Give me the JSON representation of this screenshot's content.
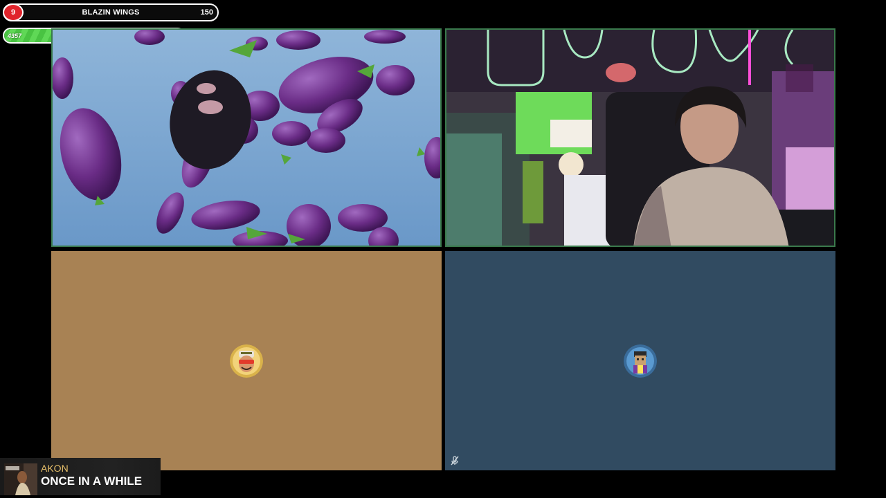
{
  "goals": {
    "sub_goal": {
      "count": "9",
      "title": "BLAZIN WINGS",
      "target": "150"
    },
    "kicks_goal": {
      "current": "4357",
      "label": "KICKS",
      "target": "3000",
      "progress": 1.0
    }
  },
  "tiles": [
    {
      "id": "stream-tile-eggplant-animation",
      "speaking": true
    },
    {
      "id": "stream-tile-streamer-webcam",
      "speaking": true
    },
    {
      "id": "participant-tile-camera-off-1",
      "avatar": "participant-avatar"
    },
    {
      "id": "participant-tile-camera-off-2",
      "avatar": "participant-avatar",
      "muted": true
    }
  ],
  "now_playing": {
    "artist": "AKON",
    "song": "ONCE IN A WHILE"
  },
  "colors": {
    "sub_badge": "#e0232b",
    "kicks_fill": "#4fc845",
    "active_speaker_border": "#3a7a4c",
    "tile3_bg": "#a88254",
    "tile4_bg": "#314b61",
    "artist_color": "#e8c06a"
  }
}
